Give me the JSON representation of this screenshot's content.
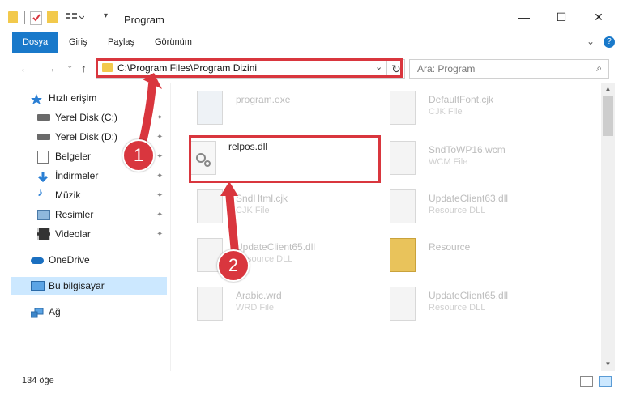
{
  "window": {
    "title": "Program",
    "controls": {
      "minimize": "—",
      "maximize": "☐",
      "close": "✕"
    }
  },
  "ribbon": {
    "tabs": [
      {
        "label": "Dosya",
        "active": true
      },
      {
        "label": "Giriş",
        "active": false
      },
      {
        "label": "Paylaş",
        "active": false
      },
      {
        "label": "Görünüm",
        "active": false
      }
    ],
    "expand_icon": "⌄",
    "help_icon": "?"
  },
  "nav": {
    "back": "←",
    "forward": "→",
    "recent": "⌄",
    "up": "↑",
    "address": "C:\\Program Files\\Program Dizini",
    "address_dropdown": "⌄",
    "refresh": "↻",
    "search_placeholder": "Ara: Program",
    "search_icon": "⌕"
  },
  "sidebar": {
    "items": [
      {
        "label": "Hızlı erişim",
        "icon": "star-icon",
        "pinned": false
      },
      {
        "label": "Yerel Disk (C:)",
        "icon": "drive-icon",
        "pinned": true
      },
      {
        "label": "Yerel Disk (D:)",
        "icon": "drive-icon",
        "pinned": true
      },
      {
        "label": "Belgeler",
        "icon": "documents-icon",
        "pinned": true
      },
      {
        "label": "İndirmeler",
        "icon": "downloads-icon",
        "pinned": true
      },
      {
        "label": "Müzik",
        "icon": "music-icon",
        "pinned": true
      },
      {
        "label": "Resimler",
        "icon": "pictures-icon",
        "pinned": true
      },
      {
        "label": "Videolar",
        "icon": "videos-icon",
        "pinned": true
      },
      {
        "label": "OneDrive",
        "icon": "cloud-icon",
        "pinned": false
      },
      {
        "label": "Bu bilgisayar",
        "icon": "computer-icon",
        "pinned": false,
        "selected": true
      },
      {
        "label": "Ağ",
        "icon": "network-icon",
        "pinned": false
      }
    ],
    "pin_glyph": "📌"
  },
  "files": [
    {
      "name": "program.exe",
      "type": "",
      "kind": "exe"
    },
    {
      "name": "DefaultFont.cjk",
      "type": "CJK File",
      "kind": "file"
    },
    {
      "name": "relpos.dll",
      "type": "",
      "kind": "dll",
      "focus": true
    },
    {
      "name": "SndToWP16.wcm",
      "type": "WCM File",
      "kind": "file"
    },
    {
      "name": "SndHtml.cjk",
      "type": "CJK File",
      "kind": "file"
    },
    {
      "name": "UpdateClient63.dll",
      "type": "Resource DLL",
      "kind": "dll"
    },
    {
      "name": "UpdateClient65.dll",
      "type": "Resource DLL",
      "kind": "dll"
    },
    {
      "name": "Resource",
      "type": "",
      "kind": "folder"
    },
    {
      "name": "Arabic.wrd",
      "type": "WRD File",
      "kind": "file"
    },
    {
      "name": "UpdateClient65.dll",
      "type": "Resource DLL",
      "kind": "dll"
    }
  ],
  "status": {
    "count": "134 öğe"
  },
  "markers": {
    "one": "1",
    "two": "2"
  },
  "colors": {
    "accent": "#1979ca",
    "highlight": "#d9363e",
    "selection": "#cce8ff"
  }
}
